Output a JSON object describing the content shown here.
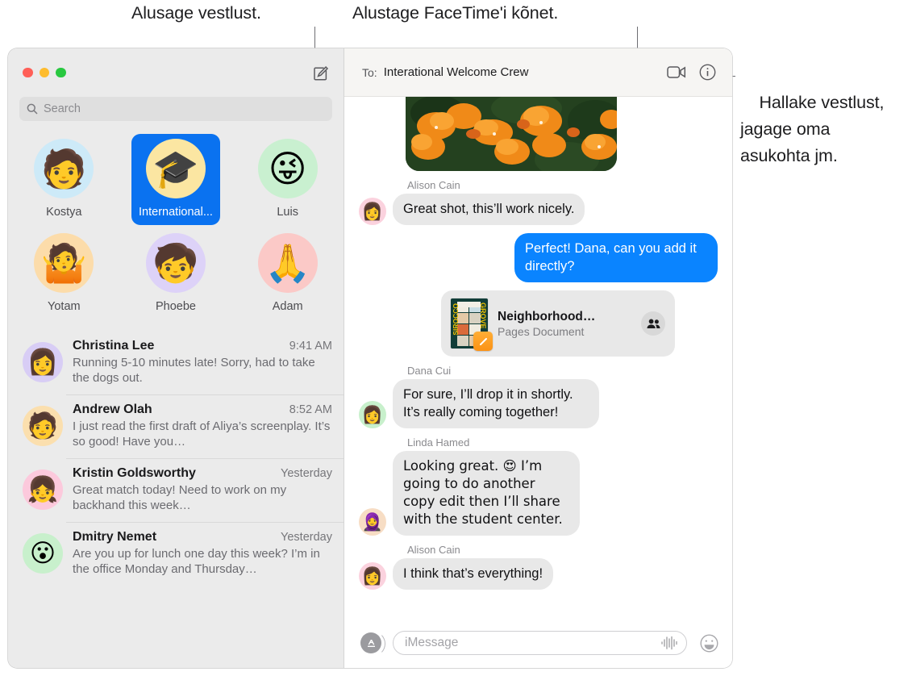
{
  "callouts": [
    {
      "id": "compose-callout",
      "text": "Alusage vestlust."
    },
    {
      "id": "facetime-callout",
      "text": "Alustage FaceTime'i kõnet."
    },
    {
      "id": "details-callout",
      "text": "Hallake vestlust,\njagage oma\nasukohta jm."
    }
  ],
  "window": {
    "traffic_lights": [
      "close",
      "minimize",
      "zoom"
    ],
    "colors": {
      "close": "#ff5f57",
      "minimize": "#febc2e",
      "zoom": "#28c840",
      "accent": "#0a84ff",
      "selected_pin": "#0a72f0"
    }
  },
  "sidebar": {
    "compose_button_label": "New Message",
    "search": {
      "placeholder": "Search",
      "value": "",
      "icon": "search-icon"
    },
    "pinned": [
      {
        "name": "Kostya",
        "avatar_bg": "#cdeaf8",
        "glyph": "🧑",
        "selected": false
      },
      {
        "name": "International...",
        "avatar_bg": "#fbe6a2",
        "glyph": "🎓",
        "selected": true
      },
      {
        "name": "Luis",
        "avatar_bg": "#c9f0d0",
        "glyph": "😜",
        "selected": false
      },
      {
        "name": "Yotam",
        "avatar_bg": "#fcdcaa",
        "glyph": "🤷",
        "selected": false
      },
      {
        "name": "Phoebe",
        "avatar_bg": "#ddd2f8",
        "glyph": "🧒",
        "selected": false
      },
      {
        "name": "Adam",
        "avatar_bg": "#fbc9c7",
        "glyph": "🙏",
        "selected": false
      }
    ],
    "conversations": [
      {
        "name": "Christina Lee",
        "time": "9:41 AM",
        "preview": "Running 5-10 minutes late! Sorry, had to take the dogs out.",
        "avatar_bg": "#d8cdf5",
        "glyph": "👩"
      },
      {
        "name": "Andrew Olah",
        "time": "8:52 AM",
        "preview": "I just read the first draft of Aliya’s screenplay. It’s so good! Have you…",
        "avatar_bg": "#fbdfae",
        "glyph": "🧑"
      },
      {
        "name": "Kristin Goldsworthy",
        "time": "Yesterday",
        "preview": "Great match today! Need to work on my backhand this week…",
        "avatar_bg": "#fcc9dc",
        "glyph": "👧"
      },
      {
        "name": "Dmitry Nemet",
        "time": "Yesterday",
        "preview": "Are you up for lunch one day this week? I’m in the office Monday and Thursday…",
        "avatar_bg": "#c8f0cc",
        "glyph": "😮"
      }
    ]
  },
  "conversation": {
    "header": {
      "to_label": "To:",
      "recipient": "Interational Welcome Crew",
      "facetime_icon": "video-camera-icon",
      "details_icon": "info-circle-icon"
    },
    "messages": [
      {
        "kind": "photo",
        "direction": "in",
        "alt": "orange flowers photo"
      },
      {
        "kind": "text",
        "direction": "in",
        "sender": "Alison Cain",
        "text": "Great shot, this’ll work nicely.",
        "avatar_bg": "#fbd2de",
        "glyph": "👩"
      },
      {
        "kind": "text",
        "direction": "out",
        "sender": "",
        "text": "Perfect! Dana, can you add it directly?"
      },
      {
        "kind": "file",
        "direction": "out",
        "file_name": "Neighborhood…",
        "file_type": "Pages Document",
        "thumb_left_text": "SIROCCO",
        "thumb_right_text": "GROVE",
        "badge_icon": "pages-app-icon",
        "shared_icon": "people-icon"
      },
      {
        "kind": "text",
        "direction": "in",
        "sender": "Dana Cui",
        "text": "For sure, I’ll drop it in shortly. It’s really coming together!",
        "avatar_bg": "#c8f0cc",
        "glyph": "👩"
      },
      {
        "kind": "text",
        "direction": "in",
        "sender": "Linda Hamed",
        "text": "Looking great. 😍 I’m going to do another copy edit then I’ll share with the student center.",
        "avatar_bg": "#f7ddc4",
        "glyph": "🧕"
      },
      {
        "kind": "text",
        "direction": "in",
        "sender": "Alison Cain",
        "text": "I think that’s everything!",
        "avatar_bg": "#fbd2de",
        "glyph": "👩"
      }
    ],
    "composer": {
      "apps_icon": "app-store-icon",
      "placeholder": "iMessage",
      "value": "",
      "audio_icon": "audio-waveform-icon",
      "emoji_icon": "smiley-face-icon"
    }
  }
}
